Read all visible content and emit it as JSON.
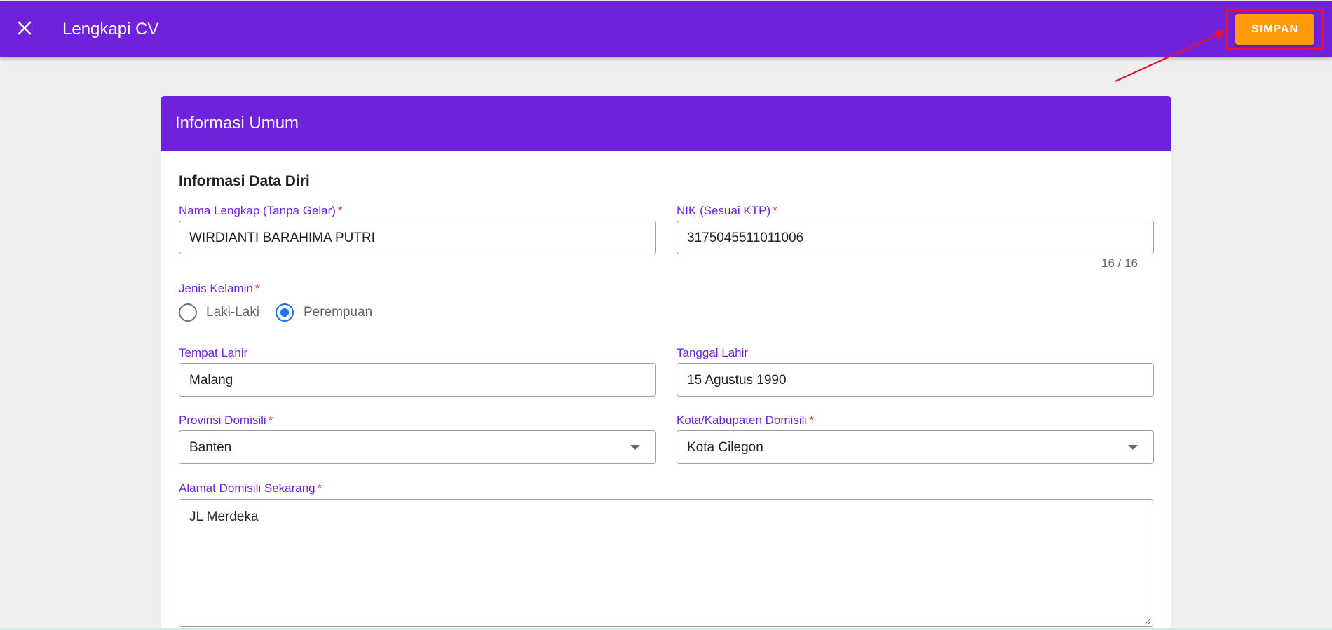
{
  "app": {
    "title": "Lengkapi CV",
    "save_label": "SIMPAN"
  },
  "card": {
    "title": "Informasi Umum",
    "section_title": "Informasi Data Diri"
  },
  "form": {
    "nama": {
      "label": "Nama Lengkap (Tanpa Gelar)",
      "required": "*",
      "value": "WIRDIANTI BARAHIMA PUTRI"
    },
    "nik": {
      "label": "NIK (Sesuai KTP)",
      "required": "*",
      "value": "3175045511011006",
      "counter": "16 / 16"
    },
    "gender": {
      "label": "Jenis Kelamin",
      "required": "*",
      "options": [
        "Laki-Laki",
        "Perempuan"
      ],
      "selected": "Perempuan"
    },
    "tempat_lahir": {
      "label": "Tempat Lahir",
      "value": "Malang"
    },
    "tanggal_lahir": {
      "label": "Tanggal Lahir",
      "value": "15 Agustus 1990"
    },
    "provinsi": {
      "label": "Provinsi Domisili",
      "required": "*",
      "value": "Banten"
    },
    "kota": {
      "label": "Kota/Kabupaten Domisili",
      "required": "*",
      "value": "Kota Cilegon"
    },
    "alamat": {
      "label": "Alamat Domisili Sekarang",
      "required": "*",
      "value": "JL Merdeka"
    }
  },
  "colors": {
    "primary": "#6f22da",
    "accent": "#ff9a0b",
    "highlight": "#e8112f",
    "radio_selected": "#1a73e8",
    "required": "#e53935"
  },
  "icons": {
    "close": "close-icon",
    "dropdown": "chevron-down-icon",
    "annotation": "arrow-icon"
  }
}
